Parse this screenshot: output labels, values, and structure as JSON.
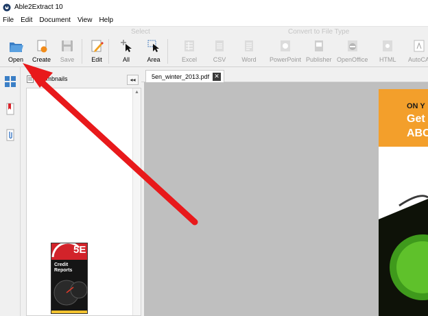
{
  "window": {
    "title": "Able2Extract 10"
  },
  "menu": [
    "File",
    "Edit",
    "Document",
    "View",
    "Help"
  ],
  "toolbar": {
    "select_group": "Select",
    "convert_group": "Convert to File Type",
    "buttons": {
      "open": "Open",
      "create": "Create",
      "save": "Save",
      "edit": "Edit",
      "all": "All",
      "area": "Area",
      "excel": "Excel",
      "csv": "CSV",
      "word": "Word",
      "powerpoint": "PowerPoint",
      "publisher": "Publisher",
      "openoffice": "OpenOffice",
      "html": "HTML",
      "autocad": "AutoCA"
    }
  },
  "thumbnails": {
    "label": "Thumbnails",
    "collapse_glyph": "◂◂",
    "page1": {
      "brand": "5E",
      "title": "Credit Reports"
    }
  },
  "document": {
    "tab_name": "5en_winter_2013.pdf",
    "close_glyph": "✕",
    "banner_line1": "ON Y",
    "banner_line2": "Get",
    "banner_line3": "ABC"
  },
  "colors": {
    "banner": "#f39f2b",
    "arrow": "#e8191b",
    "traffic_light_green": "#5fc12b"
  }
}
